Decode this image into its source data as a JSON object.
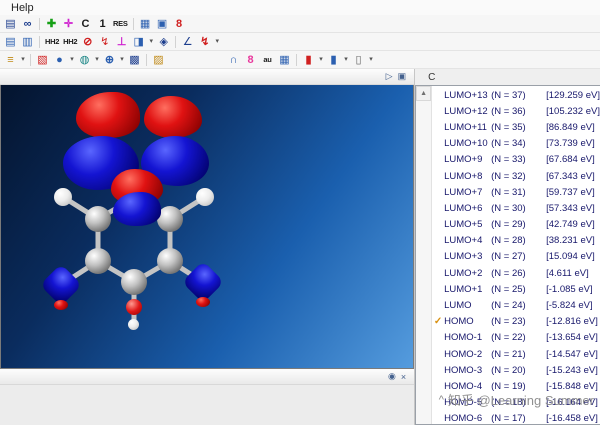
{
  "colors": {
    "orbital_positive": "#d80f0f",
    "orbital_negative": "#1212c8",
    "viewport_top": "#04142e",
    "viewport_bottom": "#559cde",
    "check": "#d89010"
  },
  "menubar": {
    "help_label": "Help"
  },
  "toolbars": {
    "row1": [
      {
        "name": "open-model-icon",
        "glyph": "▤"
      },
      {
        "name": "glasses-icon",
        "glyph": "∞"
      },
      {
        "name": "add-fragment-icon",
        "glyph": "✚"
      },
      {
        "name": "translate-icon",
        "glyph": "✛"
      },
      {
        "name": "element-c-button",
        "glyph": "C"
      },
      {
        "name": "atom-count-button",
        "glyph": "1"
      },
      {
        "name": "residue-button",
        "glyph": "RES"
      },
      {
        "name": "tile-windows-icon",
        "glyph": "▦"
      },
      {
        "name": "monitor-icon",
        "glyph": "▣"
      },
      {
        "name": "ring-counter-icon",
        "glyph": "8"
      }
    ],
    "row2": [
      {
        "name": "notebook-icon",
        "glyph": "▤"
      },
      {
        "name": "notebook-alt-icon",
        "glyph": "▥"
      },
      {
        "name": "hh2-show-icon",
        "glyph": "HH2"
      },
      {
        "name": "hh2-hide-icon",
        "glyph": "HH2"
      },
      {
        "name": "no-entry-icon",
        "glyph": "⊘"
      },
      {
        "name": "bolt-icon",
        "glyph": "↯"
      },
      {
        "name": "perpendicular-icon",
        "glyph": "⊥"
      },
      {
        "name": "plane-icon",
        "glyph": "◨"
      },
      {
        "name": "dropdown-caret-icon",
        "glyph": "▾"
      },
      {
        "name": "gem-icon",
        "glyph": "◈"
      },
      {
        "name": "angle-icon",
        "glyph": "∠"
      },
      {
        "name": "flash-icon",
        "glyph": "↯"
      },
      {
        "name": "list-caret-icon",
        "glyph": "▾"
      }
    ],
    "row3": [
      {
        "name": "layers-icon",
        "glyph": "≡"
      },
      {
        "name": "layers-caret-icon",
        "glyph": "▾"
      },
      {
        "name": "paint-icon",
        "glyph": "▧"
      },
      {
        "name": "orbital-dot-icon",
        "glyph": "●"
      },
      {
        "name": "orbital-caret-icon",
        "glyph": "▾"
      },
      {
        "name": "surface-icon",
        "glyph": "◍"
      },
      {
        "name": "surface-caret-icon",
        "glyph": "▾"
      },
      {
        "name": "add-surface-icon",
        "glyph": "⊕"
      },
      {
        "name": "add-surface-caret-icon",
        "glyph": "▾"
      },
      {
        "name": "grid-icon",
        "glyph": "▩"
      },
      {
        "name": "folder-icon",
        "glyph": "▨"
      },
      {
        "name": "magnet-icon",
        "glyph": "∩"
      },
      {
        "name": "pink-8-icon",
        "glyph": "8"
      },
      {
        "name": "au-units-button",
        "glyph": "au"
      },
      {
        "name": "palette-icon",
        "glyph": "▦"
      },
      {
        "name": "red-swatch-icon",
        "glyph": "▮"
      },
      {
        "name": "red-swatch-caret-icon",
        "glyph": "▾"
      },
      {
        "name": "blue-swatch-icon",
        "glyph": "▮"
      },
      {
        "name": "blue-swatch-caret-icon",
        "glyph": "▾"
      },
      {
        "name": "white-swatch-icon",
        "glyph": "▯"
      },
      {
        "name": "white-swatch-caret-icon",
        "glyph": "▾"
      }
    ]
  },
  "viewport_header": {
    "collapse_glyph": "▷",
    "dock_glyph": "▣"
  },
  "viewport_footer": {
    "pin_glyph": "◉",
    "close_glyph": "×"
  },
  "right_panel": {
    "header_label": "C"
  },
  "scrollbar": {
    "up_glyph": "▲"
  },
  "icons": {
    "check_glyph": "✓"
  },
  "watermark": {
    "caret_glyph": "^",
    "text": "知乎 @Learning Summer"
  },
  "orbitals": [
    {
      "name": "LUMO+13",
      "n": "(N = 37)",
      "ev": "[129.259 eV]",
      "checked": false
    },
    {
      "name": "LUMO+12",
      "n": "(N = 36)",
      "ev": "[105.232 eV]",
      "checked": false
    },
    {
      "name": "LUMO+11",
      "n": "(N = 35)",
      "ev": "[86.849 eV]",
      "checked": false
    },
    {
      "name": "LUMO+10",
      "n": "(N = 34)",
      "ev": "[73.739 eV]",
      "checked": false
    },
    {
      "name": "LUMO+9",
      "n": "(N = 33)",
      "ev": "[67.684 eV]",
      "checked": false
    },
    {
      "name": "LUMO+8",
      "n": "(N = 32)",
      "ev": "[67.343 eV]",
      "checked": false
    },
    {
      "name": "LUMO+7",
      "n": "(N = 31)",
      "ev": "[59.737 eV]",
      "checked": false
    },
    {
      "name": "LUMO+6",
      "n": "(N = 30)",
      "ev": "[57.343 eV]",
      "checked": false
    },
    {
      "name": "LUMO+5",
      "n": "(N = 29)",
      "ev": "[42.749 eV]",
      "checked": false
    },
    {
      "name": "LUMO+4",
      "n": "(N = 28)",
      "ev": "[38.231 eV]",
      "checked": false
    },
    {
      "name": "LUMO+3",
      "n": "(N = 27)",
      "ev": "[15.094 eV]",
      "checked": false
    },
    {
      "name": "LUMO+2",
      "n": "(N = 26)",
      "ev": "[4.611 eV]",
      "checked": false
    },
    {
      "name": "LUMO+1",
      "n": "(N = 25)",
      "ev": "[-1.085 eV]",
      "checked": false
    },
    {
      "name": "LUMO",
      "n": "(N = 24)",
      "ev": "[-5.824 eV]",
      "checked": false
    },
    {
      "name": "HOMO",
      "n": "(N = 23)",
      "ev": "[-12.816 eV]",
      "checked": true
    },
    {
      "name": "HOMO-1",
      "n": "(N = 22)",
      "ev": "[-13.654 eV]",
      "checked": false
    },
    {
      "name": "HOMO-2",
      "n": "(N = 21)",
      "ev": "[-14.547 eV]",
      "checked": false
    },
    {
      "name": "HOMO-3",
      "n": "(N = 20)",
      "ev": "[-15.243 eV]",
      "checked": false
    },
    {
      "name": "HOMO-4",
      "n": "(N = 19)",
      "ev": "[-15.848 eV]",
      "checked": false
    },
    {
      "name": "HOMO-5",
      "n": "(N = 18)",
      "ev": "[-16.164 eV]",
      "checked": false
    },
    {
      "name": "HOMO-6",
      "n": "(N = 17)",
      "ev": "[-16.458 eV]",
      "checked": false
    }
  ]
}
